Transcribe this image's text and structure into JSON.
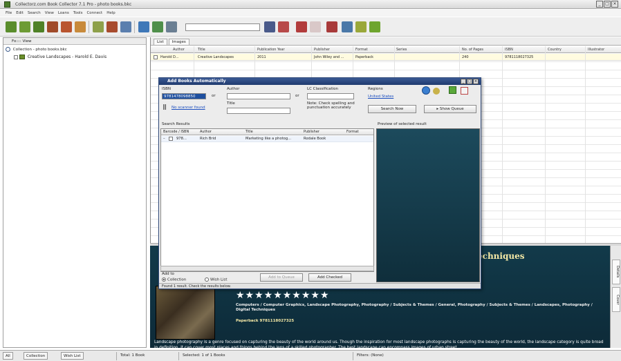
{
  "window": {
    "title": "Collectorz.com Book Collector 7.1 Pro - photo books.bkc",
    "controls": [
      "_",
      "□",
      "×"
    ]
  },
  "menu": [
    "File",
    "Edit",
    "Search",
    "View",
    "Loans",
    "Tools",
    "Connect",
    "Help"
  ],
  "left_pane": {
    "header": "Fo:::: View",
    "root_item": "Collection - photo books.bkc",
    "book_item": "Creative Landscapes - Harold E. Davis"
  },
  "main_tabs": [
    "List",
    "Images"
  ],
  "columns": [
    "Author",
    "Title",
    "Publication Year",
    "Publisher",
    "Format",
    "Series",
    "No. of Pages",
    "ISBN",
    "Country",
    "Illustrator"
  ],
  "row": {
    "author": "Harold D...",
    "title": "Creative Landscapes",
    "year": "2011",
    "publisher": "John Wiley and ...",
    "format": "Paperback",
    "pages": "240",
    "isbn": "9781118027325"
  },
  "dialog": {
    "title": "Add Books Automatically",
    "isbn_label": "ISBN",
    "isbn_value": "9781478098850",
    "or1": "or",
    "author_label": "Author",
    "or2": "or",
    "lc_label": "LC Classification",
    "regions_label": "Regions",
    "regions_link": "United States",
    "barcode_link": "No scanner found",
    "title_label": "Title",
    "note": "Note: Check spelling and punctuation accurately",
    "search_button": "Search Now",
    "show_queue_button": "▸ Show Queue",
    "search_results_label": "Search Results",
    "preview_label": "Preview of selected result",
    "result_columns": [
      "Barcode / ISBN",
      "Author",
      "Title",
      "Publisher",
      "Format"
    ],
    "result_row": {
      "isbn": "978...",
      "author": "Rich Brid",
      "title": "Marketing like a photog...",
      "publisher": "Rodale Book"
    },
    "add_to_label": "Add to",
    "radio_collection": "Collection",
    "radio_wishlist": "Wish List",
    "add_to_queue_button": "Add to Queue",
    "add_checked_button": "Add Checked",
    "status": "Found 1 result. Check the results below."
  },
  "details": {
    "title_fragment": "echniques",
    "stars": "★★★★★★★★★★",
    "genres": "Computers / Computer Graphics, Landscape Photography, Photography / Subjects & Themes / General, Photography / Subjects & Themes / Landscapes, Photography / Digital Techniques",
    "format": "Paperback 9781118027325",
    "description": "Landscape photography is a genre focused on capturing the beauty of the world around us. Though the inspiration for most landscape photographs is capturing the beauty of the world, the landscape category is quite broad in definition. It can cover most places and things behind the lens of a skilled photographer. The best landscape can encompass images of urban street..."
  },
  "right_tabs": [
    "Details",
    "Cover"
  ],
  "status": {
    "tab_all": "All",
    "tab_collection": "Collection",
    "tab_wishlist": "Wish List",
    "total": "Total: 1 Book",
    "selected": "Selected: 1 of 1 Books",
    "filters": "Filters: (None)"
  },
  "colors": {
    "detail_bg": "#123a4a",
    "title_gold": "#f5e9a6",
    "dialog_title": "#1f3a6e"
  }
}
